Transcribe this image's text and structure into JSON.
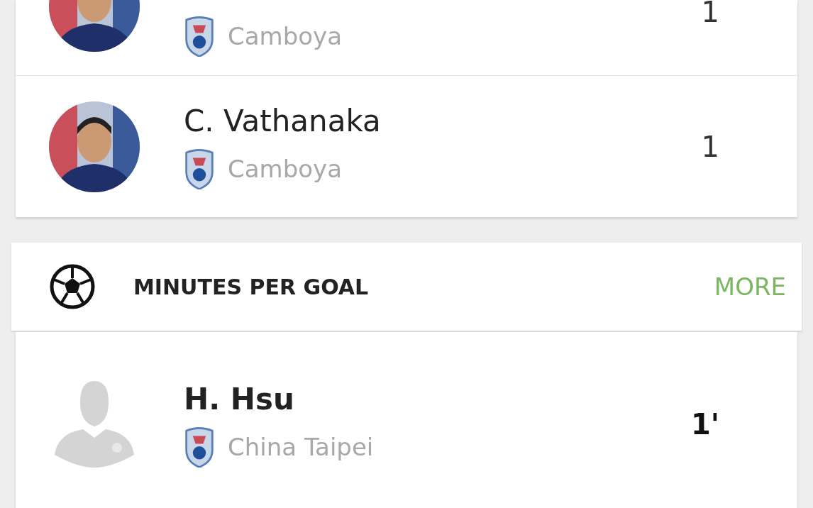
{
  "top_list": {
    "players": [
      {
        "team": "Camboya",
        "value": "1"
      },
      {
        "name": "C. Vathanaka",
        "team": "Camboya",
        "value": "1"
      }
    ]
  },
  "minutes_per_goal": {
    "title": "MINUTES PER GOAL",
    "more": "MORE",
    "players": [
      {
        "name": "H. Hsu",
        "team": "China Taipei",
        "value": "1'",
        "kind": "silhouette"
      }
    ]
  }
}
